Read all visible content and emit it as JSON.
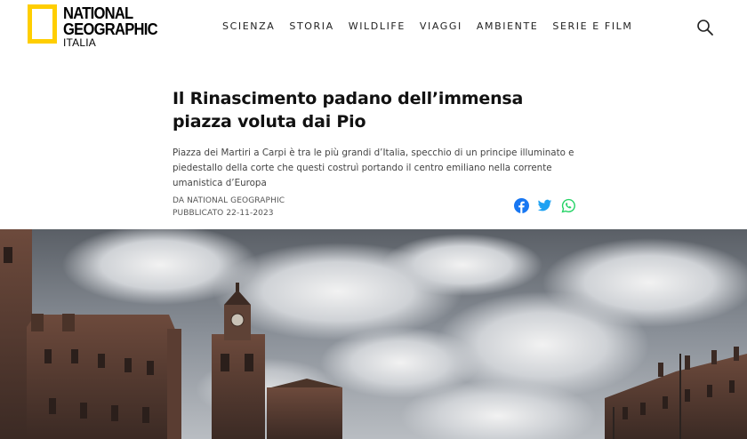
{
  "brand": {
    "line1": "NATIONAL",
    "line2": "GEOGRAPHIC",
    "line3": "ITALIA",
    "accent_color": "#ffce00"
  },
  "nav": {
    "items": [
      "SCIENZA",
      "STORIA",
      "WILDLIFE",
      "VIAGGI",
      "AMBIENTE",
      "SERIE E FILM"
    ],
    "search_icon": "search-icon"
  },
  "article": {
    "title": "Il Rinascimento padano dell’immensa piazza voluta dai Pio",
    "dek": "Piazza dei Martiri a Carpi è tra le più grandi d’Italia, specchio di un principe illuminato e piedestallo della corte che questi costruì portando il centro emiliano nella corrente umanistica d’Europa",
    "byline": "DA NATIONAL GEOGRAPHIC",
    "published": "PUBBLICATO 22-11-2023"
  },
  "share": {
    "facebook_color": "#1877f2",
    "twitter_color": "#1da1f2",
    "whatsapp_color": "#25d366"
  },
  "hero": {
    "alt_icon": "photo-piazza-image"
  }
}
